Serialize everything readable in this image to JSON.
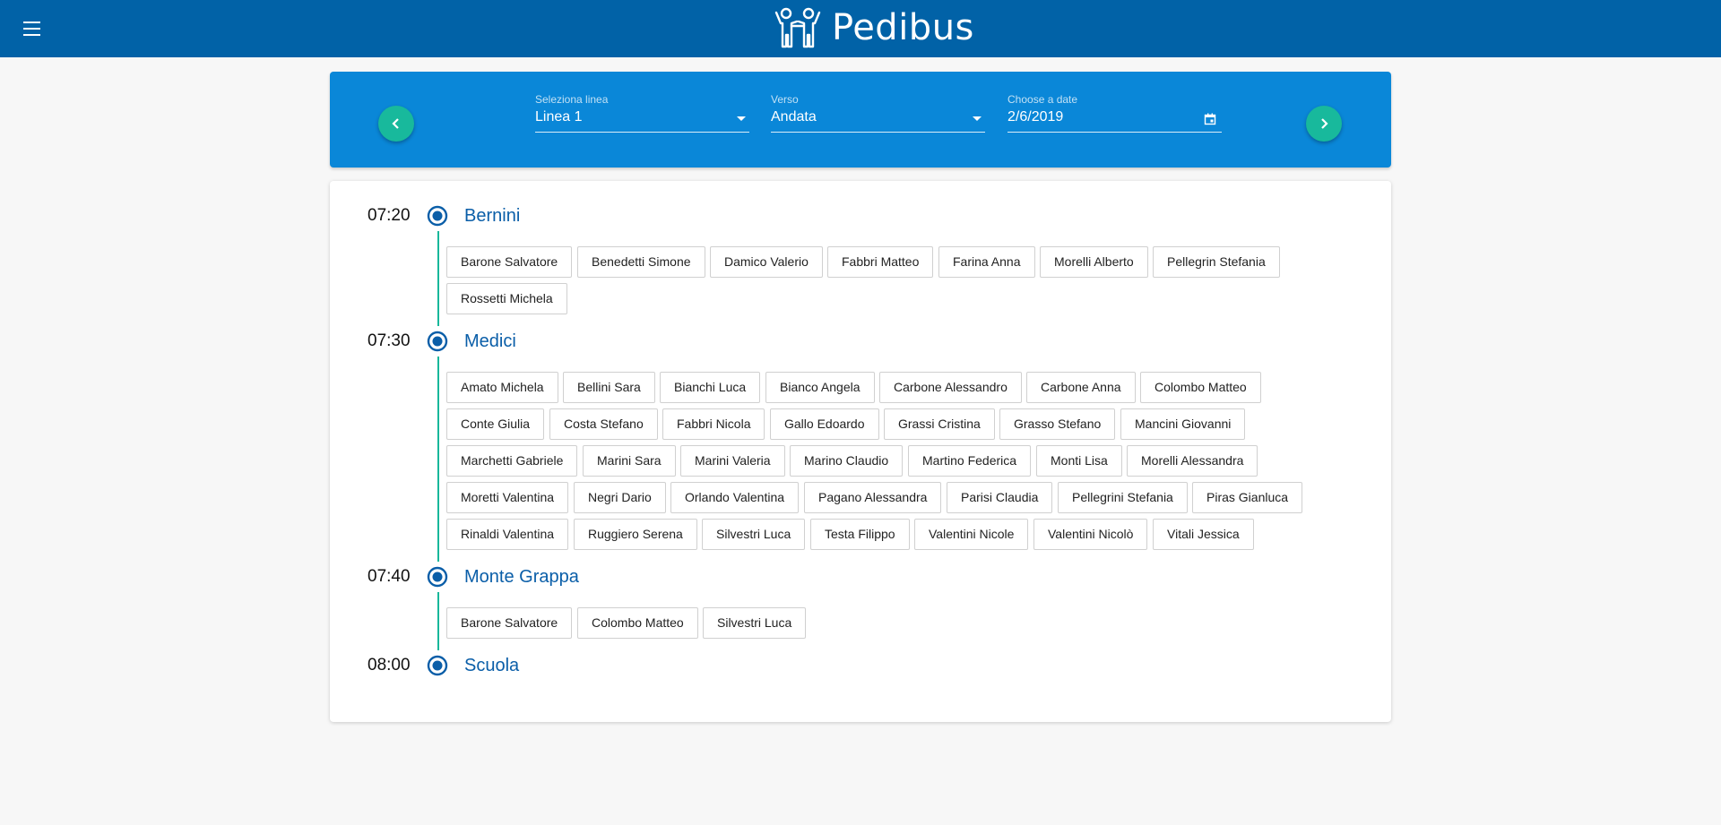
{
  "app": {
    "title": "Pedibus",
    "menu_icon": "menu-icon",
    "logo_icon": "family-logo-icon"
  },
  "colors": {
    "header": "#0162a7",
    "selector_bg": "#0a87d8",
    "accent": "#18b99c",
    "stop_name": "#0a5ea8"
  },
  "selector": {
    "line": {
      "label": "Seleziona linea",
      "value": "Linea 1"
    },
    "direction": {
      "label": "Verso",
      "value": "Andata"
    },
    "date": {
      "label": "Choose a date",
      "value": "2/6/2019"
    },
    "prev_icon": "chevron-left-icon",
    "next_icon": "chevron-right-icon"
  },
  "stops": [
    {
      "time": "07:20",
      "name": "Bernini",
      "children": [
        "Barone Salvatore",
        "Benedetti Simone",
        "Damico Valerio",
        "Fabbri Matteo",
        "Farina Anna",
        "Morelli Alberto",
        "Pellegrin Stefania",
        "Rossetti Michela"
      ]
    },
    {
      "time": "07:30",
      "name": "Medici",
      "children": [
        "Amato Michela",
        "Bellini Sara",
        "Bianchi Luca",
        "Bianco Angela",
        "Carbone Alessandro",
        "Carbone Anna",
        "Colombo Matteo",
        "Conte Giulia",
        "Costa Stefano",
        "Fabbri Nicola",
        "Gallo Edoardo",
        "Grassi Cristina",
        "Grasso Stefano",
        "Mancini Giovanni",
        "Marchetti Gabriele",
        "Marini Sara",
        "Marini Valeria",
        "Marino Claudio",
        "Martino Federica",
        "Monti Lisa",
        "Morelli Alessandra",
        "Moretti Valentina",
        "Negri Dario",
        "Orlando Valentina",
        "Pagano Alessandra",
        "Parisi Claudia",
        "Pellegrini Stefania",
        "Piras Gianluca",
        "Rinaldi Valentina",
        "Ruggiero Serena",
        "Silvestri Luca",
        "Testa Filippo",
        "Valentini Nicole",
        "Valentini Nicolò",
        "Vitali Jessica"
      ]
    },
    {
      "time": "07:40",
      "name": "Monte Grappa",
      "children": [
        "Barone Salvatore",
        "Colombo Matteo",
        "Silvestri Luca"
      ]
    },
    {
      "time": "08:00",
      "name": "Scuola",
      "children": []
    }
  ]
}
